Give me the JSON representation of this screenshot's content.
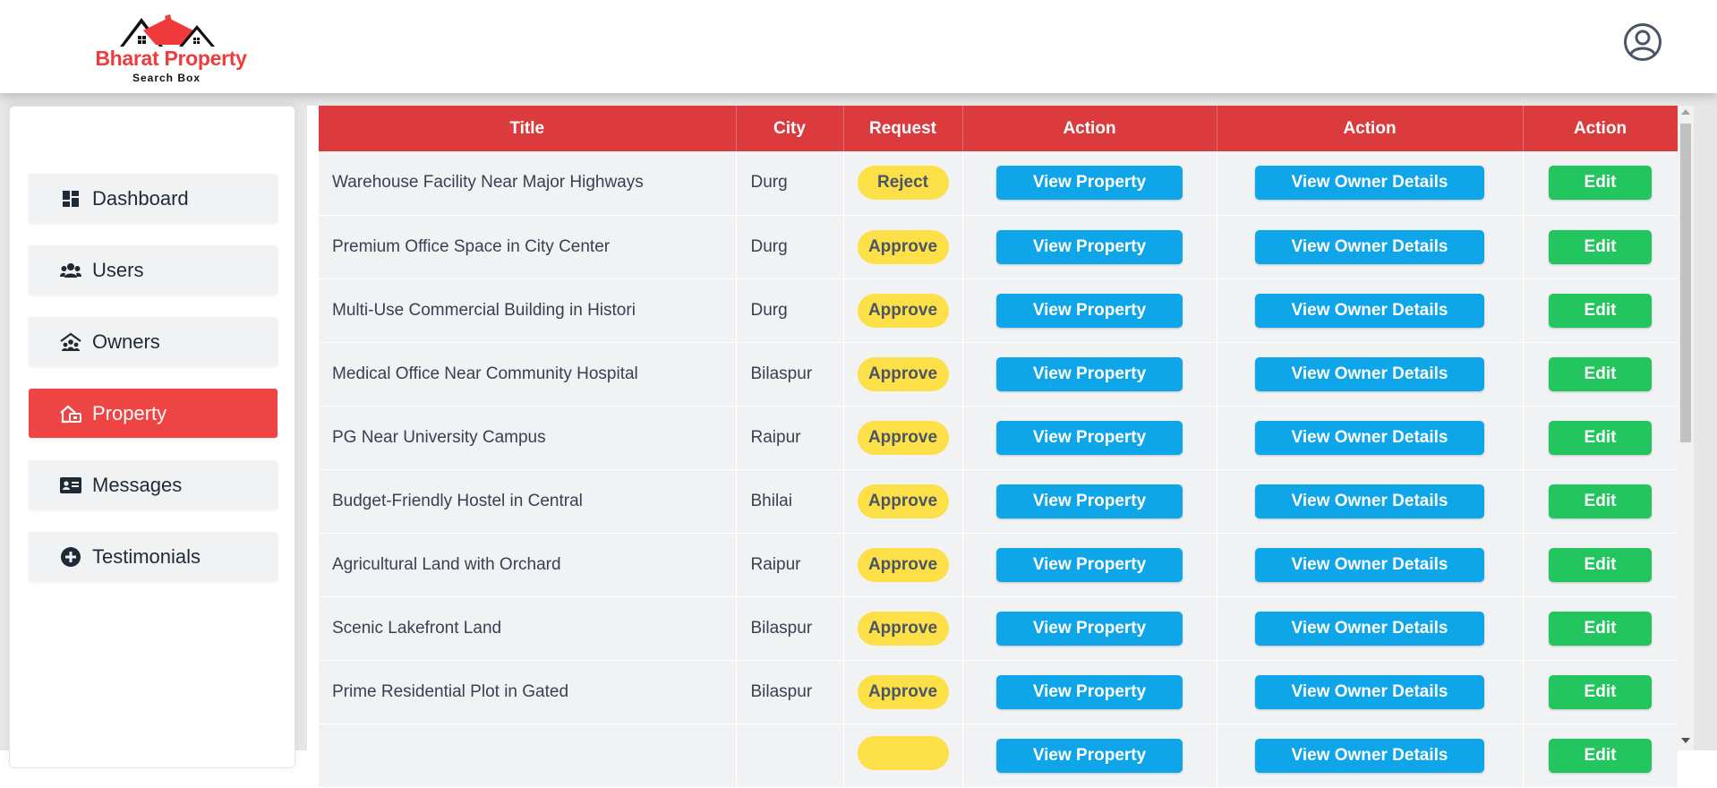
{
  "brand": {
    "title": "Bharat Property",
    "subtitle": "Search Box",
    "accent": "#ef4444"
  },
  "header": {
    "avatar_icon": "user-circle-icon"
  },
  "sidebar": {
    "items": [
      {
        "label": "Dashboard",
        "icon": "dashboard-icon",
        "active": false
      },
      {
        "label": "Users",
        "icon": "users-icon",
        "active": false
      },
      {
        "label": "Owners",
        "icon": "owners-icon",
        "active": false
      },
      {
        "label": "Property",
        "icon": "property-icon",
        "active": true
      },
      {
        "label": "Messages",
        "icon": "messages-icon",
        "active": false
      },
      {
        "label": "Testimonials",
        "icon": "plus-circle-icon",
        "active": false
      }
    ]
  },
  "table": {
    "headers": [
      "Title",
      "City",
      "Request",
      "Action",
      "Action",
      "Action"
    ],
    "view_property_label": "View Property",
    "view_owner_label": "View Owner Details",
    "edit_label": "Edit",
    "rows": [
      {
        "title": "Warehouse Facility Near Major Highways",
        "city": "Durg",
        "request": "Reject"
      },
      {
        "title": "Premium Office Space in City Center",
        "city": "Durg",
        "request": "Approve"
      },
      {
        "title": "Multi-Use Commercial Building in Histori",
        "city": "Durg",
        "request": "Approve"
      },
      {
        "title": "Medical Office Near Community Hospital",
        "city": "Bilaspur",
        "request": "Approve"
      },
      {
        "title": "PG Near University Campus",
        "city": "Raipur",
        "request": "Approve"
      },
      {
        "title": "Budget-Friendly Hostel in Central",
        "city": "Bhilai",
        "request": "Approve"
      },
      {
        "title": "Agricultural Land with Orchard",
        "city": "Raipur",
        "request": "Approve"
      },
      {
        "title": "Scenic Lakefront Land",
        "city": "Bilaspur",
        "request": "Approve"
      },
      {
        "title": "Prime Residential Plot in Gated",
        "city": "Bilaspur",
        "request": "Approve"
      },
      {
        "title": "",
        "city": "",
        "request": ""
      }
    ]
  },
  "colors": {
    "header_red": "#dc3b3e",
    "blue": "#0ea5e9",
    "green": "#22c55e",
    "yellow": "#fde047"
  }
}
